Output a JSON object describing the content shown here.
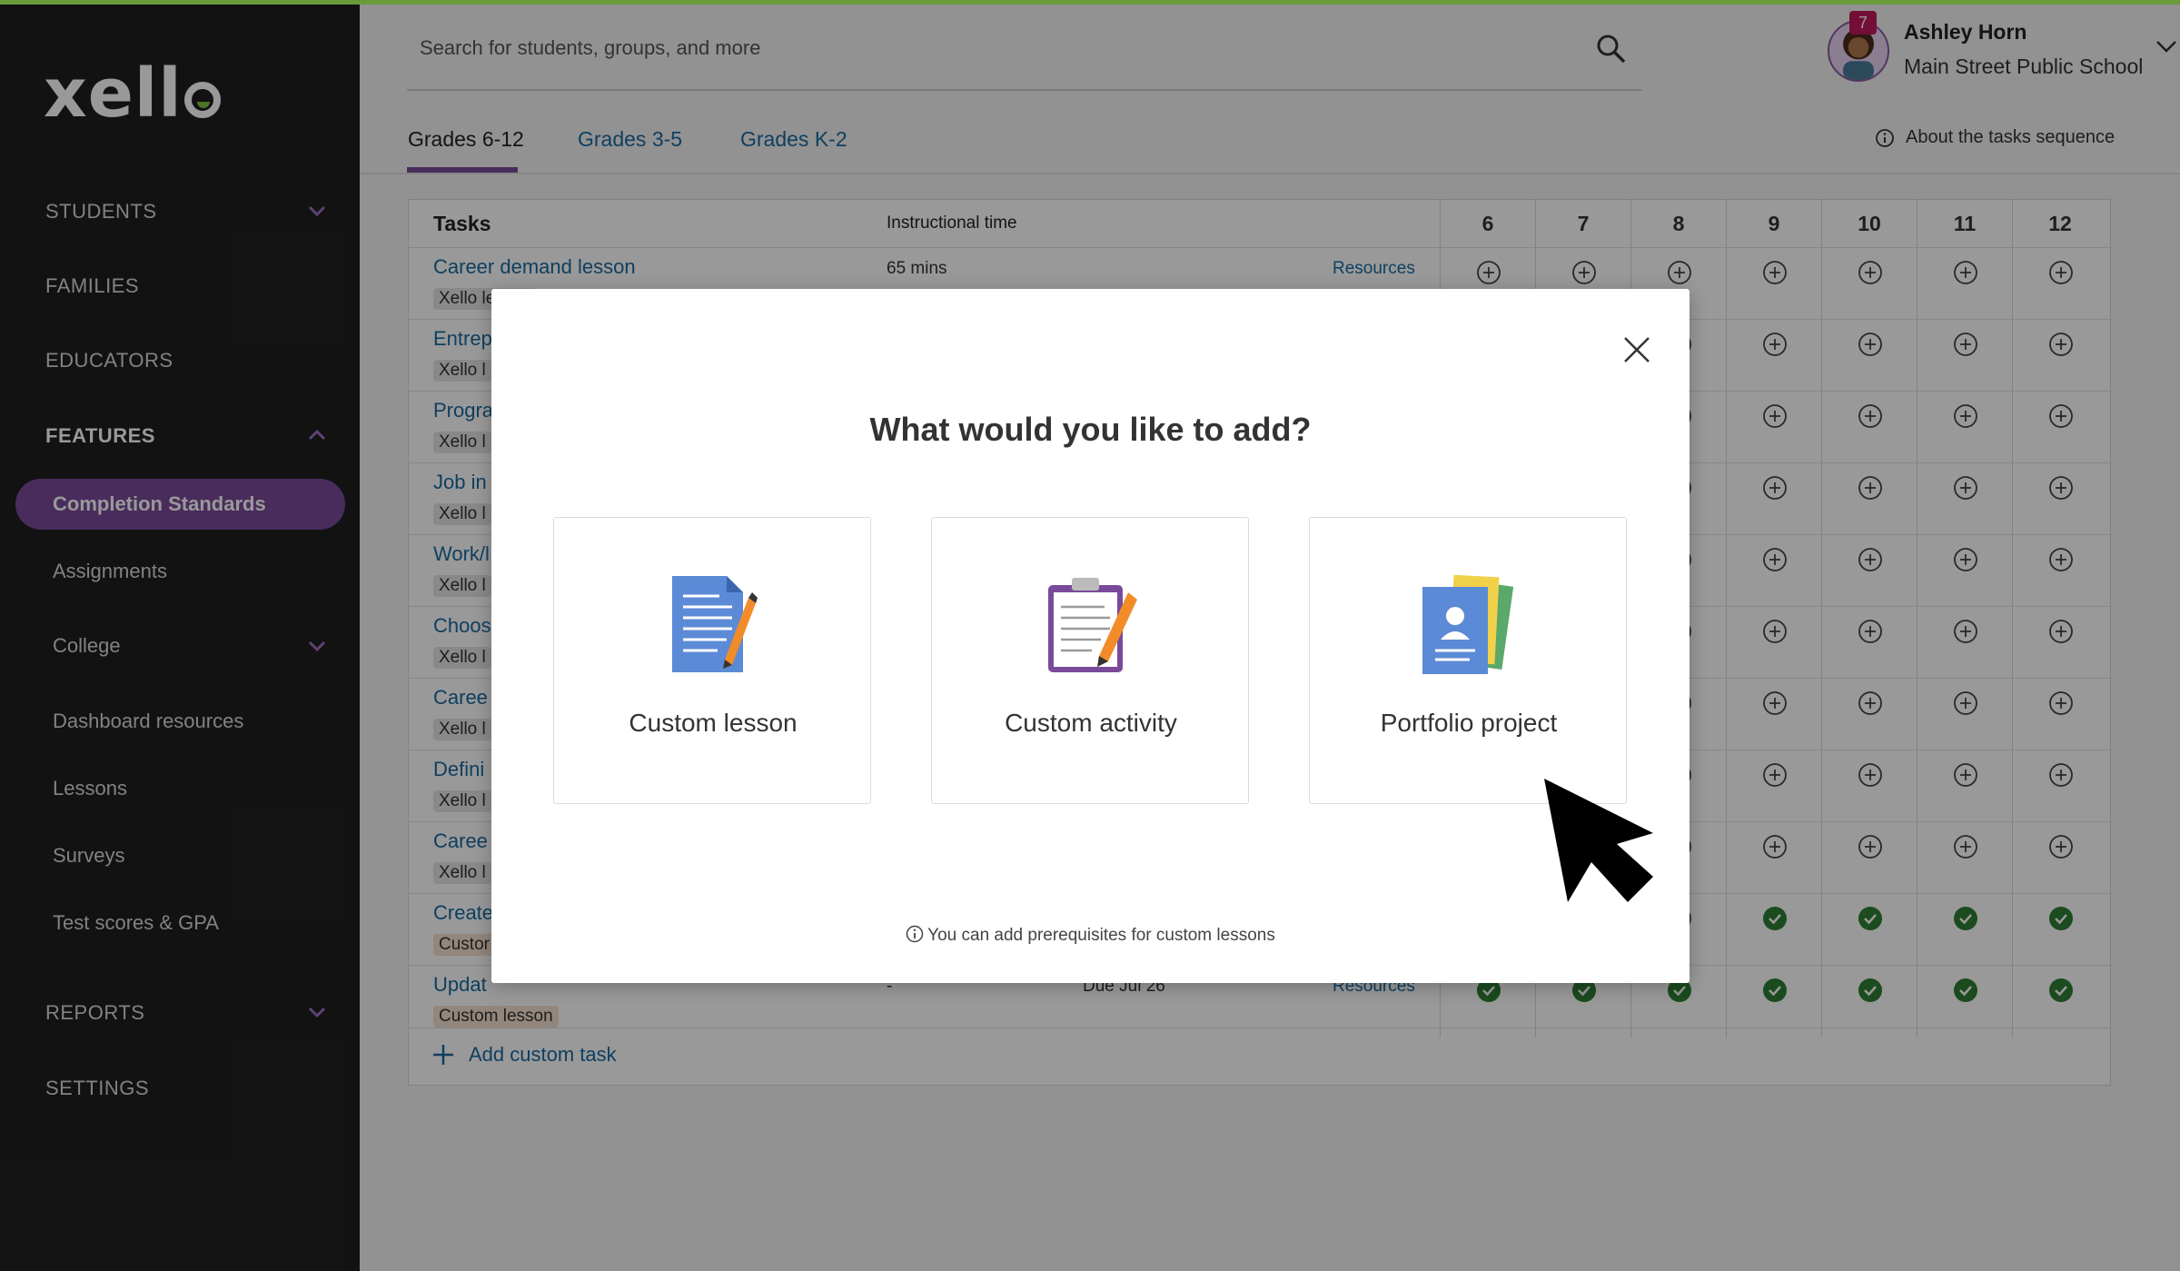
{
  "app": {
    "brand": "xello",
    "accent_color": "#7a4a9a",
    "link_color": "#1a6aa0",
    "success_color": "#2e7d32"
  },
  "sidebar": {
    "items": [
      {
        "label": "STUDENTS",
        "expandable": true
      },
      {
        "label": "FAMILIES"
      },
      {
        "label": "EDUCATORS"
      },
      {
        "label": "FEATURES",
        "expandable": true,
        "expanded": true
      },
      {
        "label": "REPORTS",
        "expandable": true
      },
      {
        "label": "SETTINGS"
      }
    ],
    "features_sub": [
      {
        "label": "Completion Standards",
        "active": true
      },
      {
        "label": "Assignments"
      },
      {
        "label": "College",
        "expandable": true
      },
      {
        "label": "Dashboard resources"
      },
      {
        "label": "Lessons"
      },
      {
        "label": "Surveys"
      },
      {
        "label": "Test scores & GPA"
      }
    ]
  },
  "header": {
    "search_placeholder": "Search for students, groups, and more",
    "notifications": "7",
    "user_name": "Ashley Horn",
    "user_school": "Main Street Public School"
  },
  "tabs": [
    {
      "label": "Grades 6-12",
      "active": true
    },
    {
      "label": "Grades 3-5"
    },
    {
      "label": "Grades K-2"
    }
  ],
  "about_link": "About the tasks sequence",
  "table": {
    "headers": {
      "tasks": "Tasks",
      "time": "Instructional time"
    },
    "grades": [
      "6",
      "7",
      "8",
      "9",
      "10",
      "11",
      "12"
    ],
    "rows": [
      {
        "title": "Career demand lesson",
        "tag": "Xello lesson",
        "time": "65 mins",
        "resources": "Resources"
      },
      {
        "title": "Entrep",
        "tag": "Xello l"
      },
      {
        "title": "Progra",
        "tag": "Xello l"
      },
      {
        "title": "Job in",
        "tag": "Xello l"
      },
      {
        "title": "Work/l",
        "tag": "Xello l"
      },
      {
        "title": "Choos",
        "tag": "Xello l"
      },
      {
        "title": "Caree",
        "tag": "Xello l"
      },
      {
        "title": "Defini",
        "tag": "Xello l"
      },
      {
        "title": "Caree",
        "tag": "Xello l"
      },
      {
        "title": "Create",
        "tag": "Custor",
        "custom": true
      },
      {
        "title": "Updat",
        "tag": "Custom lesson",
        "custom": true,
        "time": "-",
        "due": "Due Jul 26",
        "resources": "Resources"
      }
    ],
    "add_task": "Add custom task"
  },
  "modal": {
    "title": "What would you like to add?",
    "options": [
      {
        "label": "Custom lesson",
        "icon": "document-pencil-icon"
      },
      {
        "label": "Custom activity",
        "icon": "clipboard-pencil-icon"
      },
      {
        "label": "Portfolio project",
        "icon": "portfolio-cards-icon"
      }
    ],
    "note": "You can add prerequisites for custom lessons"
  }
}
